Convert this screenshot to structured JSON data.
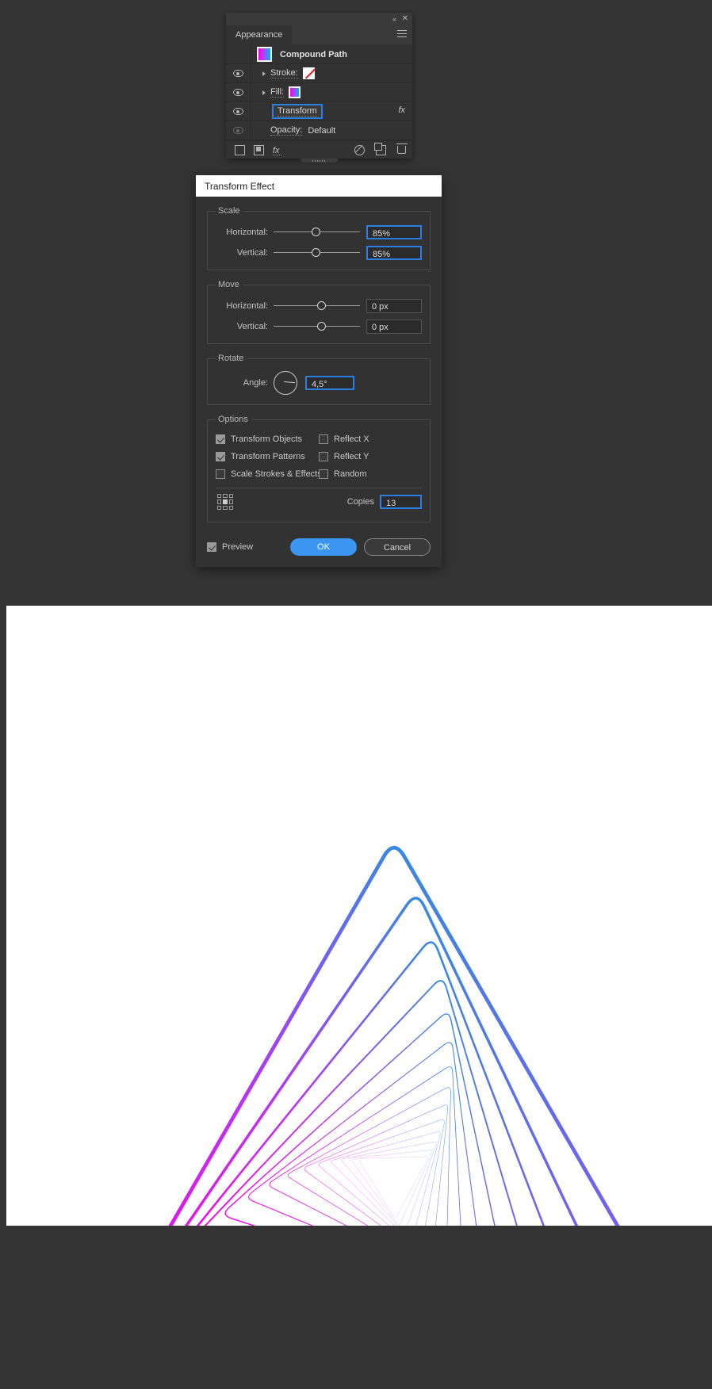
{
  "app": {
    "background_color": "#343434"
  },
  "appearance_panel": {
    "titlebar": {
      "collapse_icon": "double-chevron-left-icon",
      "collapse_glyph": "«",
      "close_icon": "close-icon",
      "close_glyph": "✕"
    },
    "tab_label": "Appearance",
    "menu_icon": "panel-menu-icon",
    "rows": [
      {
        "type": "object",
        "label": "Compound Path",
        "thumbnail": "gradient-swatch",
        "eye": false,
        "arrow": false
      },
      {
        "type": "stroke",
        "label": "Stroke:",
        "eye": true,
        "eye_state": "visible",
        "arrow": true,
        "swatch": "none-swatch"
      },
      {
        "type": "fill",
        "label": "Fill:",
        "eye": true,
        "eye_state": "visible",
        "arrow": true,
        "swatch": "gradient-swatch"
      },
      {
        "type": "effect",
        "label": "Transform",
        "eye": true,
        "eye_state": "visible",
        "arrow": false,
        "selected": true,
        "fx_badge": "fx"
      },
      {
        "type": "opacity",
        "label": "Opacity:",
        "value": "Default",
        "eye": true,
        "eye_state": "dimmed",
        "arrow": false
      }
    ],
    "footer_icons": [
      "add-new-stroke-icon",
      "add-new-fill-icon",
      "add-new-effect-icon",
      "clear-appearance-icon",
      "duplicate-item-icon",
      "delete-item-icon"
    ]
  },
  "transform_dialog": {
    "title": "Transform Effect",
    "scale": {
      "legend": "Scale",
      "horizontal_label": "Horizontal:",
      "horizontal_value": "85%",
      "horizontal_knob_pct": 44,
      "vertical_label": "Vertical:",
      "vertical_value": "85%",
      "vertical_knob_pct": 44
    },
    "move": {
      "legend": "Move",
      "horizontal_label": "Horizontal:",
      "horizontal_value": "0 px",
      "horizontal_knob_pct": 50,
      "vertical_label": "Vertical:",
      "vertical_value": "0 px",
      "vertical_knob_pct": 50
    },
    "rotate": {
      "legend": "Rotate",
      "angle_label": "Angle:",
      "angle_value": "4,5°",
      "dial_icon": "angle-dial-icon"
    },
    "options": {
      "legend": "Options",
      "items": [
        {
          "label": "Transform Objects",
          "checked": true
        },
        {
          "label": "Reflect X",
          "checked": false
        },
        {
          "label": "Transform Patterns",
          "checked": true
        },
        {
          "label": "Reflect Y",
          "checked": false
        },
        {
          "label": "Scale Strokes & Effects",
          "checked": false
        },
        {
          "label": "Random",
          "checked": false
        }
      ],
      "anchor_proxy_icon": "anchor-point-proxy-icon",
      "anchor_selected": "center",
      "copies_label": "Copies",
      "copies_value": "13"
    },
    "footer": {
      "preview_label": "Preview",
      "preview_checked": true,
      "ok_label": "OK",
      "cancel_label": "Cancel",
      "ok_color": "#3a96f0"
    }
  },
  "artwork": {
    "description": "Nested rounded triangles produced by the Transform effect",
    "shape": "rounded-triangle",
    "copies": 13,
    "total_shapes": 14,
    "scale_step_percent": 85,
    "rotate_step_degrees": 4.5,
    "gradient_start_color": "#ff00e0",
    "gradient_mid_color": "#7a5cf0",
    "gradient_end_color": "#00b9e0",
    "background_color": "#ffffff"
  }
}
